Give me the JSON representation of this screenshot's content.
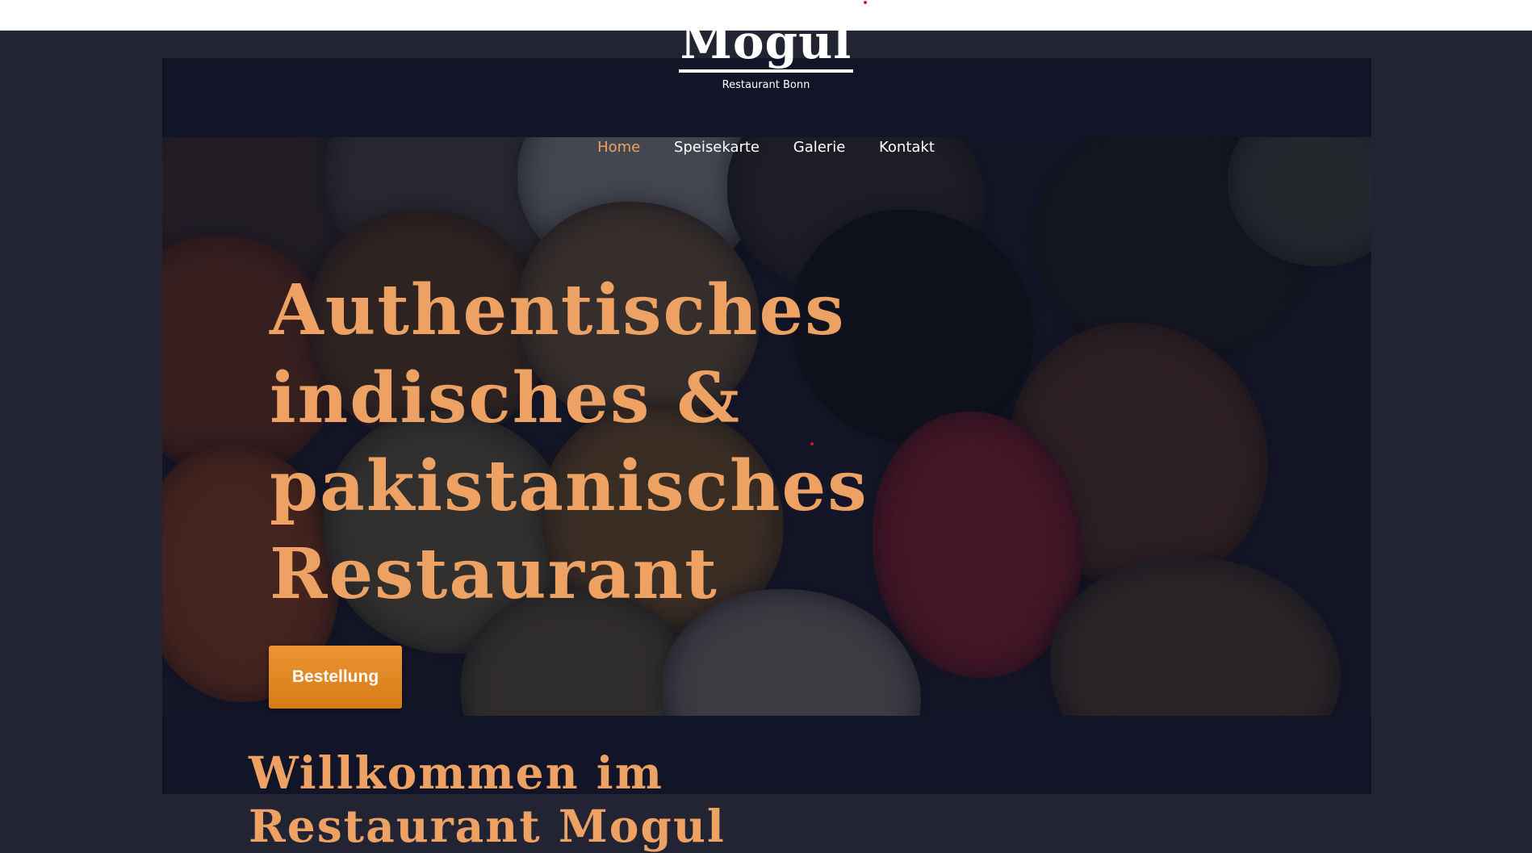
{
  "brand": {
    "name": "Mogul",
    "subtitle": "Restaurant Bonn"
  },
  "nav": {
    "items": [
      {
        "label": "Home",
        "active": true
      },
      {
        "label": "Speisekarte",
        "active": false
      },
      {
        "label": "Galerie",
        "active": false
      },
      {
        "label": "Kontakt",
        "active": false
      }
    ]
  },
  "hero": {
    "headline_lines": [
      "Authentisches",
      "indisches &",
      "pakistanisches",
      "Restaurant"
    ],
    "button_label": "Bestellung"
  },
  "welcome": {
    "heading_lines": [
      "Willkommen im",
      "Restaurant Mogul"
    ]
  },
  "colors": {
    "accent": "#eda263",
    "button": "#e08a22",
    "background": "#232433",
    "panel": "#121428"
  }
}
